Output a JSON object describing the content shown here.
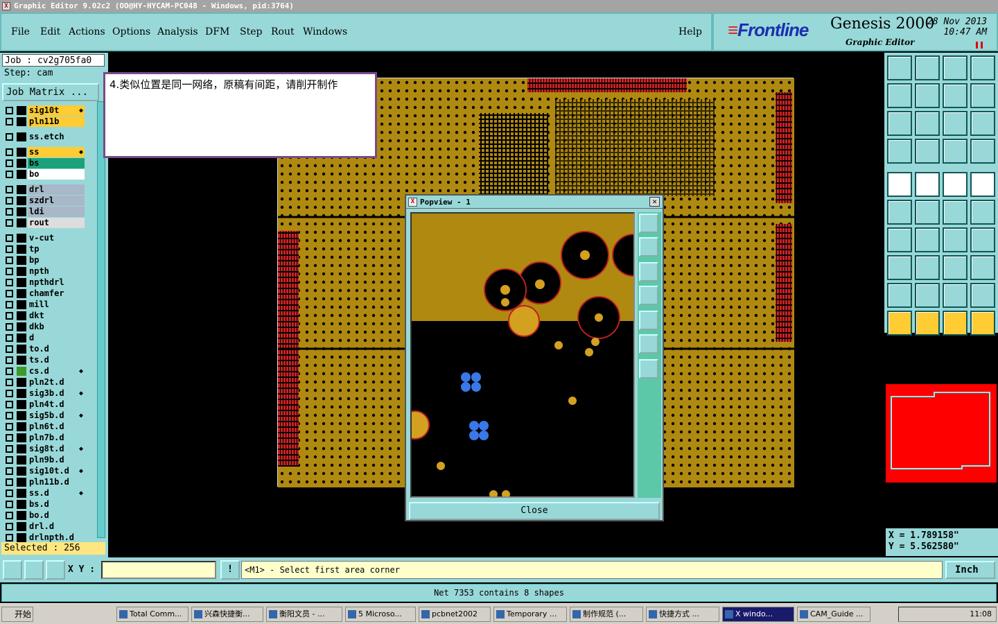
{
  "window": {
    "title": "Graphic Editor 9.02c2 (OO@HY-HYCAM-PC048 - Windows, pid:3764)"
  },
  "menu": [
    "File",
    "Edit",
    "Actions",
    "Options",
    "Analysis",
    "DFM",
    "Step",
    "Rout",
    "Windows"
  ],
  "help_label": "Help",
  "brand": {
    "logo": "Frontline",
    "product": "Genesis 2000",
    "subtitle": "Graphic Editor",
    "date": "28 Nov 2013",
    "time": "10:47 AM"
  },
  "job": {
    "job_line": "Job : cv2g705fa0",
    "step_line": "Step: cam",
    "matrix_button": "Job Matrix ..."
  },
  "layers": [
    {
      "name": "sig10t",
      "swatch": "#000",
      "label_bg": "#ffcc33",
      "mark": true
    },
    {
      "name": "pln11b",
      "swatch": "#000",
      "label_bg": "#ffcc33",
      "mark": false
    },
    {
      "name": "ss.etch",
      "swatch": "#000",
      "label_bg": "#99d8d8",
      "mark": false
    },
    {
      "name": "ss",
      "swatch": "#000",
      "label_bg": "#ffcc33",
      "mark": true
    },
    {
      "name": "bs",
      "swatch": "#000",
      "label_bg": "#1aa37a",
      "mark": false
    },
    {
      "name": "bo",
      "swatch": "#000",
      "label_bg": "#ffffff",
      "mark": false
    },
    {
      "name": "drl",
      "swatch": "#000",
      "label_bg": "#a8b8c8",
      "mark": false
    },
    {
      "name": "szdrl",
      "swatch": "#000",
      "label_bg": "#a8b8c8",
      "mark": false
    },
    {
      "name": "ldi",
      "swatch": "#000",
      "label_bg": "#a8b8c8",
      "mark": false
    },
    {
      "name": "rout",
      "swatch": "#000",
      "label_bg": "#dddddd",
      "mark": false
    },
    {
      "name": "v-cut",
      "swatch": "#000",
      "label_bg": "#99d8d8",
      "mark": false
    },
    {
      "name": "tp",
      "swatch": "#000",
      "label_bg": "#99d8d8",
      "mark": false
    },
    {
      "name": "bp",
      "swatch": "#000",
      "label_bg": "#99d8d8",
      "mark": false
    },
    {
      "name": "npth",
      "swatch": "#000",
      "label_bg": "#99d8d8",
      "mark": false
    },
    {
      "name": "npthdrl",
      "swatch": "#000",
      "label_bg": "#99d8d8",
      "mark": false
    },
    {
      "name": "chamfer",
      "swatch": "#000",
      "label_bg": "#99d8d8",
      "mark": false
    },
    {
      "name": "mill",
      "swatch": "#000",
      "label_bg": "#99d8d8",
      "mark": false
    },
    {
      "name": "dkt",
      "swatch": "#000",
      "label_bg": "#99d8d8",
      "mark": false
    },
    {
      "name": "dkb",
      "swatch": "#000",
      "label_bg": "#99d8d8",
      "mark": false
    },
    {
      "name": "d",
      "swatch": "#000",
      "label_bg": "#99d8d8",
      "mark": false
    },
    {
      "name": "to.d",
      "swatch": "#000",
      "label_bg": "#99d8d8",
      "mark": false
    },
    {
      "name": "ts.d",
      "swatch": "#000",
      "label_bg": "#99d8d8",
      "mark": false
    },
    {
      "name": "cs.d",
      "swatch": "#3a9a2a",
      "label_bg": "#99d8d8",
      "mark": true
    },
    {
      "name": "pln2t.d",
      "swatch": "#000",
      "label_bg": "#99d8d8",
      "mark": false
    },
    {
      "name": "sig3b.d",
      "swatch": "#000",
      "label_bg": "#99d8d8",
      "mark": true
    },
    {
      "name": "pln4t.d",
      "swatch": "#000",
      "label_bg": "#99d8d8",
      "mark": false
    },
    {
      "name": "sig5b.d",
      "swatch": "#000",
      "label_bg": "#99d8d8",
      "mark": true
    },
    {
      "name": "pln6t.d",
      "swatch": "#000",
      "label_bg": "#99d8d8",
      "mark": false
    },
    {
      "name": "pln7b.d",
      "swatch": "#000",
      "label_bg": "#99d8d8",
      "mark": false
    },
    {
      "name": "sig8t.d",
      "swatch": "#000",
      "label_bg": "#99d8d8",
      "mark": true
    },
    {
      "name": "pln9b.d",
      "swatch": "#000",
      "label_bg": "#99d8d8",
      "mark": false
    },
    {
      "name": "sig10t.d",
      "swatch": "#000",
      "label_bg": "#99d8d8",
      "mark": true
    },
    {
      "name": "pln11b.d",
      "swatch": "#000",
      "label_bg": "#99d8d8",
      "mark": false
    },
    {
      "name": "ss.d",
      "swatch": "#000",
      "label_bg": "#99d8d8",
      "mark": true
    },
    {
      "name": "bs.d",
      "swatch": "#000",
      "label_bg": "#99d8d8",
      "mark": false
    },
    {
      "name": "bo.d",
      "swatch": "#000",
      "label_bg": "#99d8d8",
      "mark": false
    },
    {
      "name": "drl.d",
      "swatch": "#000",
      "label_bg": "#99d8d8",
      "mark": false
    },
    {
      "name": "drlnpth.d",
      "swatch": "#000",
      "label_bg": "#99d8d8",
      "mark": false
    }
  ],
  "mark_glyph": "◆",
  "selected": "Selected : 256",
  "note": "4.类似位置是同一网络，原稿有间距，请削开制作",
  "popview": {
    "title": "Popview - 1",
    "close_button": "Close",
    "close_x": "✕"
  },
  "coords": {
    "x": "X = 1.789158\"",
    "y": "Y = 5.562580\""
  },
  "bottom": {
    "xy_label": "X Y :",
    "xy_value": "",
    "prompt": "<M1> - Select first area corner",
    "unit": "Inch",
    "alert": "!"
  },
  "status": "Net 7353 contains 8 shapes",
  "taskbar": {
    "start": "开始",
    "tasks": [
      "Total Comm...",
      "兴森快捷衡...",
      "衡阳文员 - ...",
      "5 Microso...",
      "pcbnet2002",
      "Temporary ...",
      "制作规范 (...",
      "快捷方式 ...",
      "X windo...",
      "CAM_Guide ..."
    ],
    "clock": "11:08"
  },
  "colors": {
    "panel": "#99d8d8",
    "copper": "#b08a10",
    "highlight": "#ff0000"
  }
}
